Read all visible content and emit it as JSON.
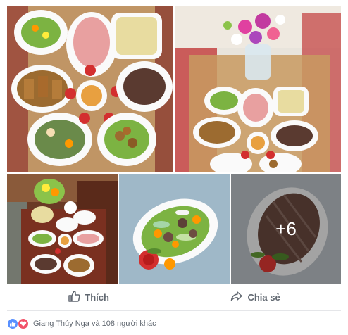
{
  "gallery": {
    "more_count": "+6",
    "photos": [
      {
        "name": "food-photo-table-overhead"
      },
      {
        "name": "food-photo-table-with-flowers"
      },
      {
        "name": "food-photo-full-table"
      },
      {
        "name": "food-photo-vegetable-dish"
      },
      {
        "name": "food-photo-sliced-meat"
      }
    ]
  },
  "actions": {
    "like_label": "Thích",
    "share_label": "Chia sẻ"
  },
  "reactions": {
    "summary": "Giang Thúy Nga và 108 người khác",
    "colors": {
      "like": "#5890ff",
      "love": "#f25268"
    }
  }
}
